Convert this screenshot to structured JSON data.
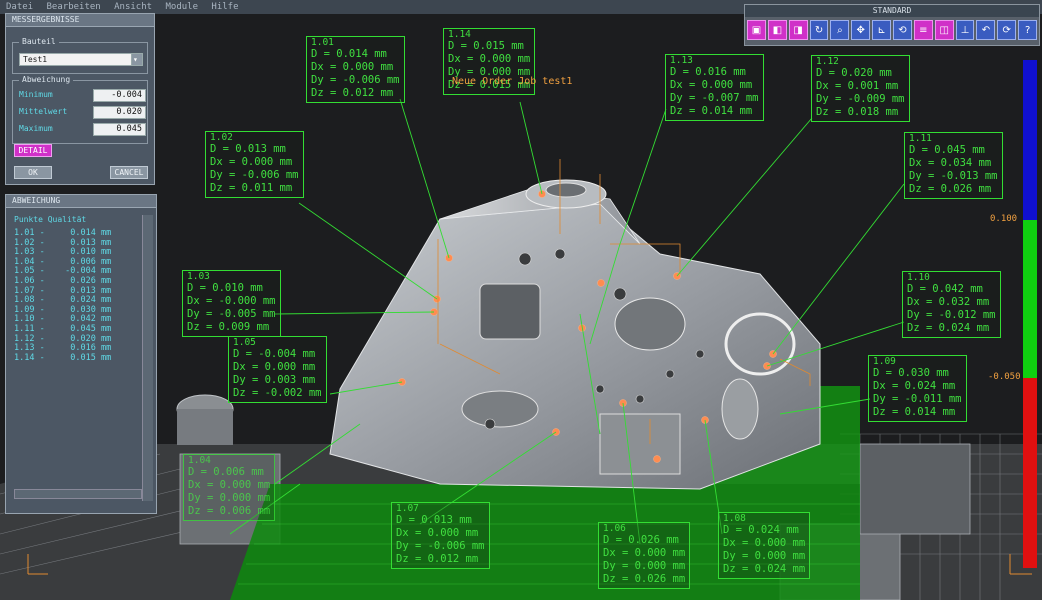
{
  "menubar": [
    "Datei",
    "Bearbeiten",
    "Ansicht",
    "Module",
    "Hilfe"
  ],
  "toolbar": {
    "title": "STANDARD",
    "icons": [
      "cube-icon",
      "cube-front-icon",
      "cube-side-icon",
      "rotate-icon",
      "zoom-icon",
      "pan-icon",
      "axis-icon",
      "reset-view-icon",
      "list-icon",
      "layers-icon",
      "measure-icon",
      "undo-icon",
      "refresh-icon",
      "help-icon"
    ]
  },
  "job_label": "Neue Order Job test1",
  "scale": {
    "upper_label": "0.100",
    "lower_label": "-0.050",
    "colors": [
      "#1010d0",
      "#10d010",
      "#e01010"
    ]
  },
  "results_panel": {
    "title": "MESSERGEBNISSE",
    "part_group": "Bauteil",
    "part_value": "Test1",
    "deviation_group": "Abweichung",
    "rows": [
      {
        "label": "Minimum",
        "value": "-0.004"
      },
      {
        "label": "Mittelwert",
        "value": "0.020"
      },
      {
        "label": "Maximum",
        "value": "0.045"
      }
    ],
    "detail_button": "DETAIL",
    "ok_button": "OK",
    "cancel_button": "CANCEL"
  },
  "deviation_panel": {
    "title": "ABWEICHUNG",
    "list_header": "Punkte Qualität",
    "rows": [
      "1.01 -     0.014 mm",
      "1.02 -     0.013 mm",
      "1.03 -     0.010 mm",
      "1.04 -     0.006 mm",
      "1.05 -    -0.004 mm",
      "1.06 -     0.026 mm",
      "1.07 -     0.013 mm",
      "1.08 -     0.024 mm",
      "1.09 -     0.030 mm",
      "1.10 -     0.042 mm",
      "1.11 -     0.045 mm",
      "1.12 -     0.020 mm",
      "1.13 -     0.016 mm",
      "1.14 -     0.015 mm"
    ]
  },
  "callouts": [
    {
      "id": "1.01",
      "lines": [
        "D = 0.014 mm",
        "Dx = 0.000 mm",
        "Dy = -0.006 mm",
        "Dz = 0.012 mm"
      ]
    },
    {
      "id": "1.14",
      "lines": [
        "D = 0.015 mm",
        "Dx = 0.000 mm",
        "Dy = 0.000 mm",
        "Dz = 0.015 mm"
      ]
    },
    {
      "id": "1.13",
      "lines": [
        "D = 0.016 mm",
        "Dx = 0.000 mm",
        "Dy = -0.007 mm",
        "Dz = 0.014 mm"
      ]
    },
    {
      "id": "1.12",
      "lines": [
        "D = 0.020 mm",
        "Dx = 0.001 mm",
        "Dy = -0.009 mm",
        "Dz = 0.018 mm"
      ]
    },
    {
      "id": "1.02",
      "lines": [
        "D = 0.013 mm",
        "Dx = 0.000 mm",
        "Dy = -0.006 mm",
        "Dz = 0.011 mm"
      ]
    },
    {
      "id": "1.11",
      "lines": [
        "D = 0.045 mm",
        "Dx = 0.034 mm",
        "Dy = -0.013 mm",
        "Dz = 0.026 mm"
      ]
    },
    {
      "id": "1.03",
      "lines": [
        "D = 0.010 mm",
        "Dx = -0.000 mm",
        "Dy = -0.005 mm",
        "Dz = 0.009 mm"
      ]
    },
    {
      "id": "1.10",
      "lines": [
        "D = 0.042 mm",
        "Dx = 0.032 mm",
        "Dy = -0.012 mm",
        "Dz = 0.024 mm"
      ]
    },
    {
      "id": "1.05",
      "lines": [
        "D = -0.004 mm",
        "Dx = 0.000 mm",
        "Dy = 0.003 mm",
        "Dz = -0.002 mm"
      ]
    },
    {
      "id": "1.09",
      "lines": [
        "D = 0.030 mm",
        "Dx = 0.024 mm",
        "Dy = -0.011 mm",
        "Dz = 0.014 mm"
      ]
    },
    {
      "id": "1.04",
      "lines": [
        "D = 0.006 mm",
        "Dx = 0.000 mm",
        "Dy = 0.000 mm",
        "Dz = 0.006 mm"
      ]
    },
    {
      "id": "1.07",
      "lines": [
        "D = 0.013 mm",
        "Dx = 0.000 mm",
        "Dy = -0.006 mm",
        "Dz = 0.012 mm"
      ]
    },
    {
      "id": "1.06",
      "lines": [
        "D = 0.026 mm",
        "Dx = 0.000 mm",
        "Dy = 0.000 mm",
        "Dz = 0.026 mm"
      ]
    },
    {
      "id": "1.08",
      "lines": [
        "D = 0.024 mm",
        "Dx = 0.000 mm",
        "Dy = 0.000 mm",
        "Dz = 0.024 mm"
      ]
    }
  ]
}
